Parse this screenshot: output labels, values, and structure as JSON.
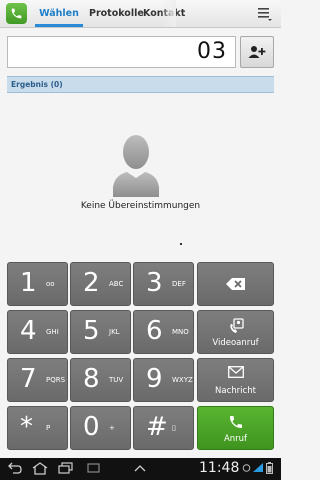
{
  "tabs": [
    {
      "label": "Wählen"
    },
    {
      "label": "Protokolle"
    },
    {
      "label": "Kontakt"
    }
  ],
  "dial": {
    "number": "03"
  },
  "results": {
    "label": "Ergebnis (0)"
  },
  "empty_state": {
    "message": "Keine Übereinstimmungen"
  },
  "keypad": [
    {
      "digit": "1",
      "letters": "oo"
    },
    {
      "digit": "2",
      "letters": "ABC"
    },
    {
      "digit": "3",
      "letters": "DEF"
    },
    {
      "digit": "4",
      "letters": "GHI"
    },
    {
      "digit": "5",
      "letters": "JKL"
    },
    {
      "digit": "6",
      "letters": "MNO"
    },
    {
      "digit": "7",
      "letters": "PQRS"
    },
    {
      "digit": "8",
      "letters": "TUV"
    },
    {
      "digit": "9",
      "letters": "WXYZ"
    },
    {
      "digit": "*",
      "letters": "P"
    },
    {
      "digit": "0",
      "letters": "+"
    },
    {
      "digit": "#",
      "letters": "▯"
    }
  ],
  "actions": {
    "videocall": "Videoanruf",
    "message": "Nachricht",
    "call": "Anruf"
  },
  "statusbar": {
    "time": "11:48"
  }
}
